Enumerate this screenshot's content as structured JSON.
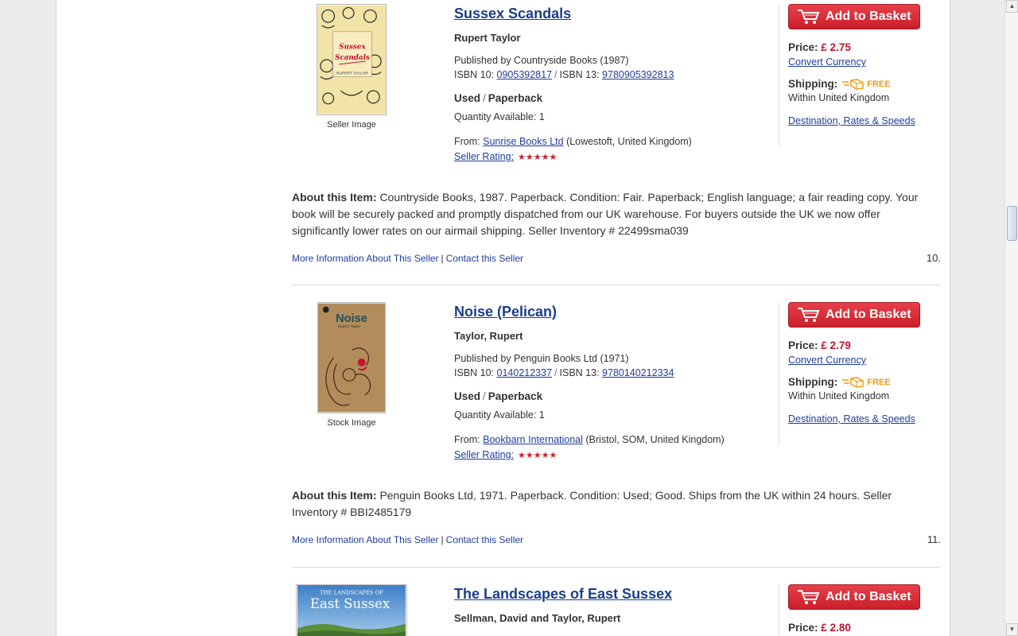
{
  "listings": [
    {
      "title": "Sussex Scandals",
      "author": "Rupert Taylor",
      "published": "Published by Countryside Books (1987)",
      "isbn10_label": "ISBN 10:",
      "isbn10": "0905392817",
      "isbn13_label": "ISBN 13:",
      "isbn13": "9780905392813",
      "condition": "Used",
      "binding": "Paperback",
      "quantity": "Quantity Available: 1",
      "from_label": "From:",
      "seller": "Sunrise Books Ltd",
      "seller_location": "(Lowestoft, United Kingdom)",
      "rating_label": "Seller Rating:",
      "rating_stars": 5,
      "image_caption": "Seller Image",
      "cover_title": "Sussex Scandals",
      "cover_author": "RUPERT TAYLOR",
      "basket_label": "Add to Basket",
      "price_label": "Price:",
      "price": "£ 2.75",
      "convert_currency": "Convert Currency",
      "shipping_label": "Shipping:",
      "shipping_free": "FREE",
      "shipping_within": "Within United Kingdom",
      "destination_link": "Destination, Rates & Speeds",
      "about_label": "About this Item:",
      "about_text": "Countryside Books, 1987. Paperback. Condition: Fair. Paperback; English language; a fair reading copy. Your book will be securely packed and promptly dispatched from our UK warehouse. For buyers outside the UK we now offer significantly lower rates on our airmail shipping. Seller Inventory # 22499sma039",
      "more_info": "More Information About This Seller",
      "contact": "Contact this Seller",
      "result_number": "10."
    },
    {
      "title": "Noise (Pelican)",
      "author": "Taylor, Rupert",
      "published": "Published by Penguin Books Ltd (1971)",
      "isbn10_label": "ISBN 10:",
      "isbn10": "0140212337",
      "isbn13_label": "ISBN 13:",
      "isbn13": "9780140212334",
      "condition": "Used",
      "binding": "Paperback",
      "quantity": "Quantity Available: 1",
      "from_label": "From:",
      "seller": "Bookbarn International",
      "seller_location": "(Bristol, SOM, United Kingdom)",
      "rating_label": "Seller Rating:",
      "rating_stars": 5,
      "image_caption": "Stock Image",
      "cover_title": "Noise",
      "cover_author": "Rupert Taylor",
      "basket_label": "Add to Basket",
      "price_label": "Price:",
      "price": "£ 2.79",
      "convert_currency": "Convert Currency",
      "shipping_label": "Shipping:",
      "shipping_free": "FREE",
      "shipping_within": "Within United Kingdom",
      "destination_link": "Destination, Rates & Speeds",
      "about_label": "About this Item:",
      "about_text": "Penguin Books Ltd, 1971. Paperback. Condition: Used; Good. Ships from the UK within 24 hours. Seller Inventory # BBI2485179",
      "more_info": "More Information About This Seller",
      "contact": "Contact this Seller",
      "result_number": "11."
    },
    {
      "title": "The Landscapes of East Sussex",
      "author": "Sellman, David and Taylor, Rupert",
      "cover_top": "THE LANDSCAPES OF",
      "cover_title": "East Sussex",
      "basket_label": "Add to Basket",
      "price_label": "Price:",
      "price": "£ 2.80"
    }
  ],
  "colors": {
    "link": "#1f3d9b",
    "title": "#1a3e8a",
    "price": "#c4122f",
    "button": "#d42c36",
    "free": "#f39a12",
    "stars": "#cc1f2f"
  }
}
